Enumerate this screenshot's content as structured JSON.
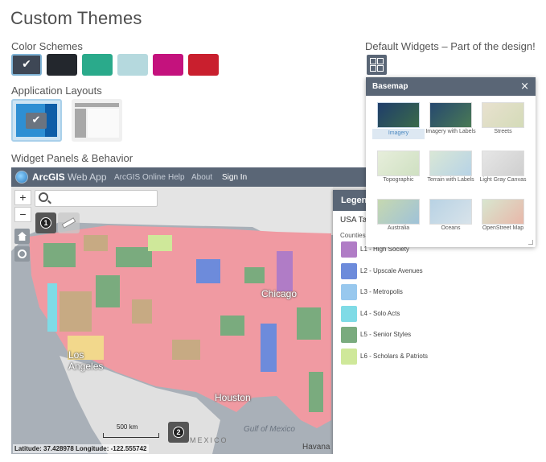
{
  "page_title": "Custom Themes",
  "color_schemes": {
    "label": "Color Schemes",
    "swatches": [
      "#3e4755",
      "#23272d",
      "#2aaa8b",
      "#b5d9de",
      "#c4127d",
      "#c91f2e"
    ],
    "selected_index": 0
  },
  "application_layouts": {
    "label": "Application Layouts",
    "selected_index": 0
  },
  "widget_panels": {
    "label": "Widget Panels & Behavior"
  },
  "default_widgets": {
    "label": "Default Widgets – Part of the design!"
  },
  "app": {
    "name_bold": "ArcGIS",
    "name_light": "Web App",
    "nav": [
      "ArcGIS Online",
      "Help",
      "About",
      "Sign In"
    ]
  },
  "map": {
    "zoom_in": "+",
    "zoom_out": "−",
    "badge_1": "1",
    "badge_2": "2",
    "cities": [
      "Chicago",
      "Los Angeles",
      "Houston"
    ],
    "sea": "Gulf of Mexico",
    "partial_labels": [
      "Havana",
      "MEXICO"
    ],
    "scale_label": "500 km",
    "coordinates": "Latitude: 37.428978  Longitude: -122.555742"
  },
  "legend": {
    "title": "Legend",
    "layer": "USA Tapestry",
    "sublabel": "Counties",
    "items": [
      {
        "label": "L1 - High Society",
        "color": "#b07cc6"
      },
      {
        "label": "L2 - Upscale Avenues",
        "color": "#6d8bdb"
      },
      {
        "label": "L3 - Metropolis",
        "color": "#98c8ee"
      },
      {
        "label": "L4 - Solo Acts",
        "color": "#7fdbe6"
      },
      {
        "label": "L5 - Senior Styles",
        "color": "#7aab7e"
      },
      {
        "label": "L6 - Scholars & Patriots",
        "color": "#cfe89a"
      }
    ]
  },
  "basemap": {
    "title": "Basemap",
    "close": "×",
    "items": [
      {
        "label": "Imagery",
        "colors": [
          "#1f3d6b",
          "#3a6a4a"
        ],
        "selected": true
      },
      {
        "label": "Imagery with Labels",
        "colors": [
          "#26486f",
          "#4a7a55"
        ],
        "selected": false
      },
      {
        "label": "Streets",
        "colors": [
          "#e8e1cf",
          "#d4dbb8"
        ],
        "selected": false
      },
      {
        "label": "Topographic",
        "colors": [
          "#e7eedb",
          "#cfe0c2"
        ],
        "selected": false
      },
      {
        "label": "Terrain with Labels",
        "colors": [
          "#d9e7d6",
          "#b7d3e6"
        ],
        "selected": false
      },
      {
        "label": "Light Gray Canvas",
        "colors": [
          "#e6e6e6",
          "#cfcfcf"
        ],
        "selected": false
      },
      {
        "label": "Australia",
        "colors": [
          "#c6d8b0",
          "#9fc2d8"
        ],
        "selected": false
      },
      {
        "label": "Oceans",
        "colors": [
          "#b8d2e4",
          "#d8e3ea"
        ],
        "selected": false
      },
      {
        "label": "OpenStreet Map",
        "colors": [
          "#d8e6cf",
          "#e8b7a9"
        ],
        "selected": false
      }
    ]
  }
}
